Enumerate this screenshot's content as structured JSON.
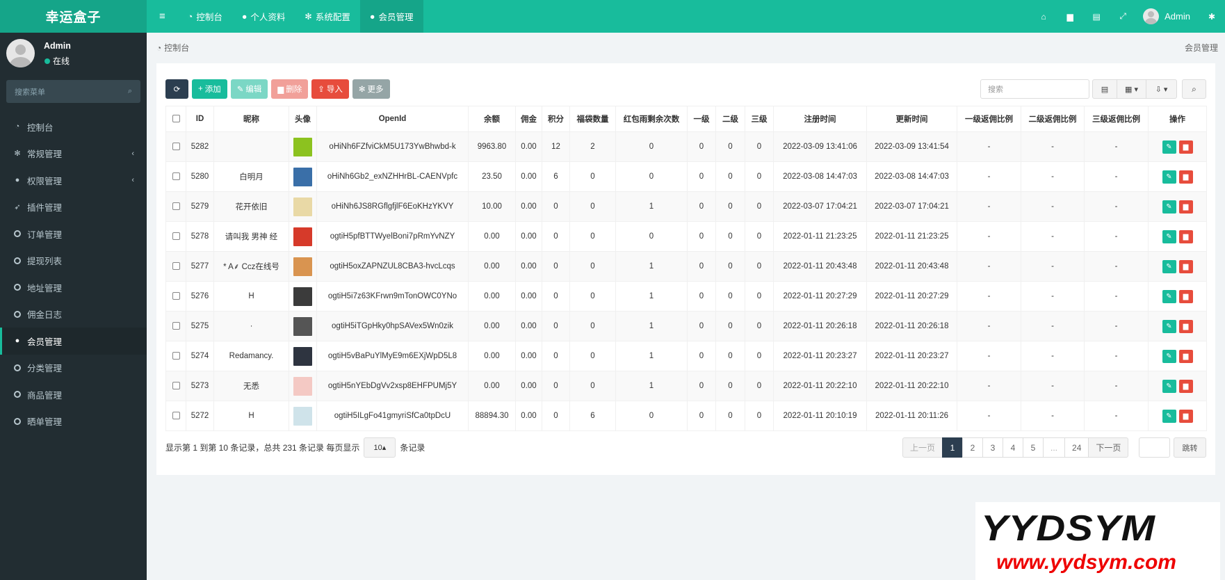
{
  "app": {
    "logo": "幸运盒子"
  },
  "topnav": {
    "items": [
      {
        "icon": "dashboard-icon",
        "label": "控制台"
      },
      {
        "icon": "user-icon",
        "label": "个人资料"
      },
      {
        "icon": "gear-icon",
        "label": "系统配置"
      },
      {
        "icon": "user-icon",
        "label": "会员管理"
      }
    ],
    "right_user": "Admin"
  },
  "sidebar": {
    "user_name": "Admin",
    "status": "在线",
    "search_placeholder": "搜索菜单",
    "items": [
      {
        "label": "控制台",
        "icon": "dashboard-icon"
      },
      {
        "label": "常规管理",
        "icon": "cogs-icon"
      },
      {
        "label": "权限管理",
        "icon": "group-icon"
      },
      {
        "label": "插件管理",
        "icon": "rocket-icon"
      },
      {
        "label": "订单管理",
        "icon": "circle-icon"
      },
      {
        "label": "提现列表",
        "icon": "circle-icon"
      },
      {
        "label": "地址管理",
        "icon": "circle-icon"
      },
      {
        "label": "佣金日志",
        "icon": "circle-icon"
      },
      {
        "label": "会员管理",
        "icon": "user-icon"
      },
      {
        "label": "分类管理",
        "icon": "circle-icon"
      },
      {
        "label": "商品管理",
        "icon": "circle-icon"
      },
      {
        "label": "晒单管理",
        "icon": "circle-icon"
      }
    ]
  },
  "breadcrumb": {
    "label": "控制台"
  },
  "page_title": "会员管理",
  "toolbar": {
    "add": "添加",
    "edit": "编辑",
    "delete": "删除",
    "import": "导入",
    "more": "更多",
    "search_placeholder": "搜索"
  },
  "table": {
    "headers": [
      "ID",
      "昵称",
      "头像",
      "OpenId",
      "余额",
      "佣金",
      "积分",
      "福袋数量",
      "红包雨剩余次数",
      "一级",
      "二级",
      "三级",
      "注册时间",
      "更新时间",
      "一级返佣比例",
      "二级返佣比例",
      "三级返佣比例",
      "操作"
    ],
    "rows": [
      {
        "id": "5282",
        "nickname": "",
        "avatar_color": "#8cc21f",
        "openid": "oHiNh6FZfviCkM5U173YwBhwbd-k",
        "balance": "9963.80",
        "commission": "0.00",
        "points": "12",
        "bags": "2",
        "redpacket": "0",
        "l1": "0",
        "l2": "0",
        "l3": "0",
        "reg": "2022-03-09 13:41:06",
        "upd": "2022-03-09 13:41:54",
        "r1": "-",
        "r2": "-",
        "r3": "-"
      },
      {
        "id": "5280",
        "nickname": "白明月",
        "avatar_color": "#3a6fa8",
        "openid": "oHiNh6Gb2_exNZHHrBL-CAENVpfc",
        "balance": "23.50",
        "commission": "0.00",
        "points": "6",
        "bags": "0",
        "redpacket": "0",
        "l1": "0",
        "l2": "0",
        "l3": "0",
        "reg": "2022-03-08 14:47:03",
        "upd": "2022-03-08 14:47:03",
        "r1": "-",
        "r2": "-",
        "r3": "-"
      },
      {
        "id": "5279",
        "nickname": "花开依旧",
        "avatar_color": "#e9d9a6",
        "openid": "oHiNh6JS8RGflgfjlF6EoKHzYKVY",
        "balance": "10.00",
        "commission": "0.00",
        "points": "0",
        "bags": "0",
        "redpacket": "1",
        "l1": "0",
        "l2": "0",
        "l3": "0",
        "reg": "2022-03-07 17:04:21",
        "upd": "2022-03-07 17:04:21",
        "r1": "-",
        "r2": "-",
        "r3": "-"
      },
      {
        "id": "5278",
        "nickname": "请叫我 男神 经",
        "avatar_color": "#d63a2a",
        "openid": "ogtiH5pfBTTWyelBoni7pRmYvNZY",
        "balance": "0.00",
        "commission": "0.00",
        "points": "0",
        "bags": "0",
        "redpacket": "0",
        "l1": "0",
        "l2": "0",
        "l3": "0",
        "reg": "2022-01-11 21:23:25",
        "upd": "2022-01-11 21:23:25",
        "r1": "-",
        "r2": "-",
        "r3": "-"
      },
      {
        "id": "5277",
        "nickname": "* A⸙ Ccz在线号",
        "avatar_color": "#d99450",
        "openid": "ogtiH5oxZAPNZUL8CBA3-hvcLcqs",
        "balance": "0.00",
        "commission": "0.00",
        "points": "0",
        "bags": "0",
        "redpacket": "1",
        "l1": "0",
        "l2": "0",
        "l3": "0",
        "reg": "2022-01-11 20:43:48",
        "upd": "2022-01-11 20:43:48",
        "r1": "-",
        "r2": "-",
        "r3": "-"
      },
      {
        "id": "5276",
        "nickname": "H",
        "avatar_color": "#3b3b3b",
        "openid": "ogtiH5i7z63KFrwn9mTonOWC0YNo",
        "balance": "0.00",
        "commission": "0.00",
        "points": "0",
        "bags": "0",
        "redpacket": "1",
        "l1": "0",
        "l2": "0",
        "l3": "0",
        "reg": "2022-01-11 20:27:29",
        "upd": "2022-01-11 20:27:29",
        "r1": "-",
        "r2": "-",
        "r3": "-"
      },
      {
        "id": "5275",
        "nickname": "·",
        "avatar_color": "#555555",
        "openid": "ogtiH5iTGpHky0hpSAVex5Wn0zik",
        "balance": "0.00",
        "commission": "0.00",
        "points": "0",
        "bags": "0",
        "redpacket": "1",
        "l1": "0",
        "l2": "0",
        "l3": "0",
        "reg": "2022-01-11 20:26:18",
        "upd": "2022-01-11 20:26:18",
        "r1": "-",
        "r2": "-",
        "r3": "-"
      },
      {
        "id": "5274",
        "nickname": "Redamancy.",
        "avatar_color": "#2e3440",
        "openid": "ogtiH5vBaPuYlMyE9m6EXjWpD5L8",
        "balance": "0.00",
        "commission": "0.00",
        "points": "0",
        "bags": "0",
        "redpacket": "1",
        "l1": "0",
        "l2": "0",
        "l3": "0",
        "reg": "2022-01-11 20:23:27",
        "upd": "2022-01-11 20:23:27",
        "r1": "-",
        "r2": "-",
        "r3": "-"
      },
      {
        "id": "5273",
        "nickname": "无悉",
        "avatar_color": "#f4c9c4",
        "openid": "ogtiH5nYEbDgVv2xsp8EHFPUMj5Y",
        "balance": "0.00",
        "commission": "0.00",
        "points": "0",
        "bags": "0",
        "redpacket": "1",
        "l1": "0",
        "l2": "0",
        "l3": "0",
        "reg": "2022-01-11 20:22:10",
        "upd": "2022-01-11 20:22:10",
        "r1": "-",
        "r2": "-",
        "r3": "-"
      },
      {
        "id": "5272",
        "nickname": "H",
        "avatar_color": "#cfe3ea",
        "openid": "ogtiH5ILgFo41gmyriSfCa0tpDcU",
        "balance": "88894.30",
        "commission": "0.00",
        "points": "0",
        "bags": "6",
        "redpacket": "0",
        "l1": "0",
        "l2": "0",
        "l3": "0",
        "reg": "2022-01-11 20:10:19",
        "upd": "2022-01-11 20:11:26",
        "r1": "-",
        "r2": "-",
        "r3": "-"
      }
    ]
  },
  "pagination": {
    "info_prefix": "显示第 1 到第 10 条记录，总共 231 条记录 每页显示",
    "page_size": "10",
    "info_suffix": "条记录",
    "prev": "上一页",
    "pages": [
      "1",
      "2",
      "3",
      "4",
      "5",
      "...",
      "24"
    ],
    "next": "下一页",
    "jump": "跳转"
  },
  "watermark": {
    "line1": "YYDSYM",
    "line2": "www.yydsym.com"
  },
  "colors": {
    "primary": "#18bc9c",
    "sidebar": "#222d32",
    "danger": "#e74c3c",
    "dark": "#2c3e50"
  }
}
